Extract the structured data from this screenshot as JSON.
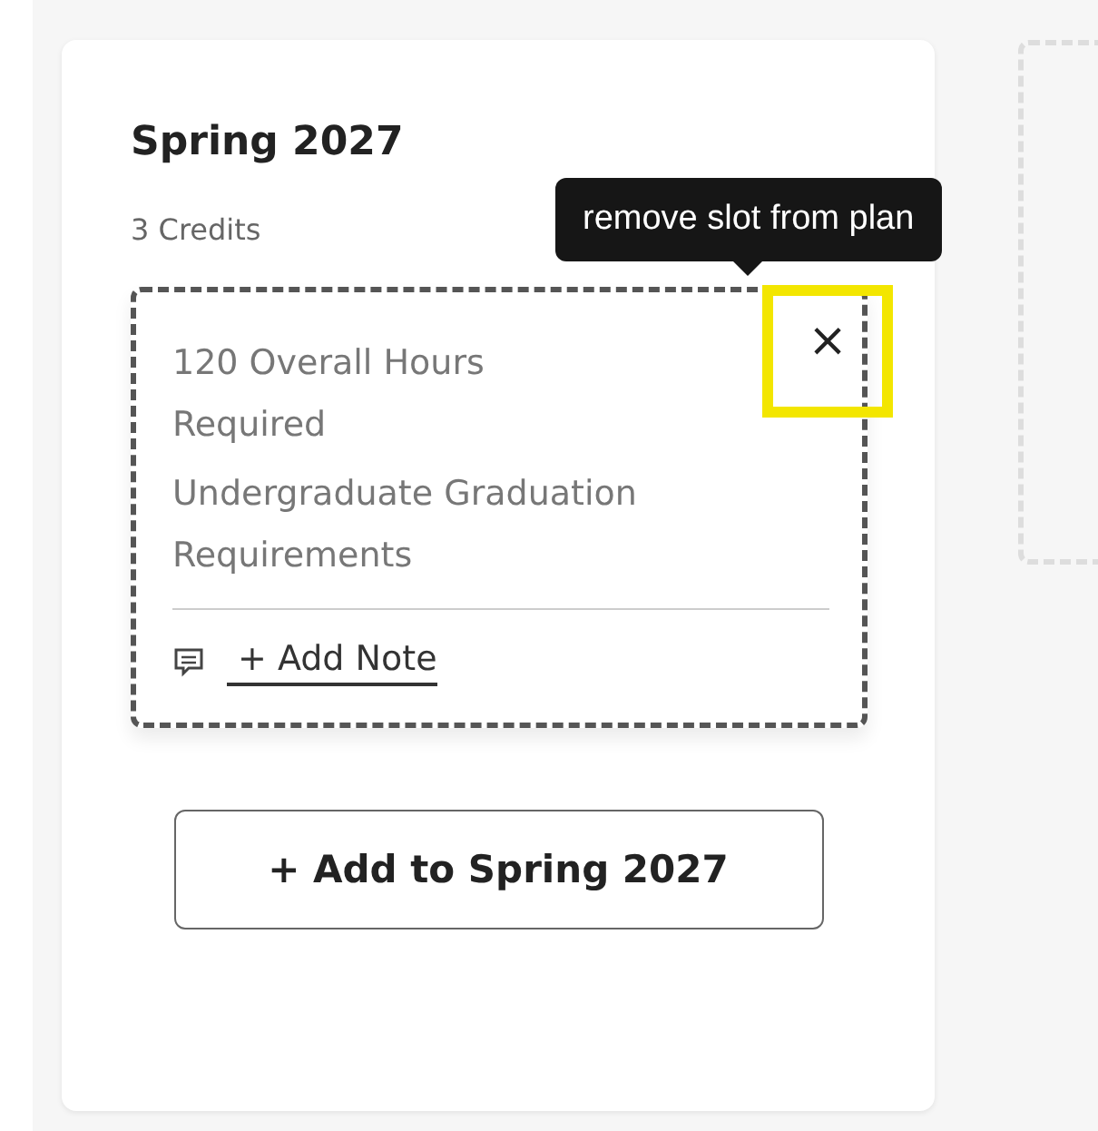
{
  "term": {
    "title": "Spring 2027",
    "credits": "3 Credits",
    "slot": {
      "lines": [
        "120 Overall Hours Required",
        "Undergraduate Graduation Requirements"
      ],
      "add_note": "+ Add Note",
      "close_button": {
        "label": "×",
        "highlighted": true
      }
    },
    "tooltip": "remove slot from plan",
    "add_button": "+ Add to Spring 2027"
  }
}
